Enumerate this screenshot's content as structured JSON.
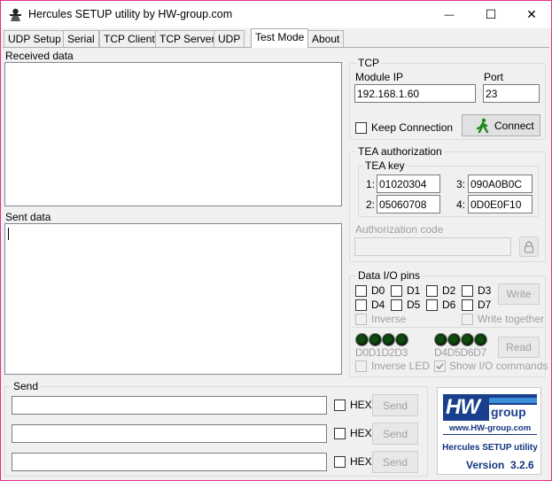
{
  "window": {
    "title": "Hercules SETUP utility by HW-group.com",
    "minimize_glyph": "—",
    "maximize_glyph": "☐",
    "close_glyph": "✕"
  },
  "tabs": [
    {
      "label": "UDP Setup"
    },
    {
      "label": "Serial"
    },
    {
      "label": "TCP Client"
    },
    {
      "label": "TCP Server"
    },
    {
      "label": "UDP"
    },
    {
      "label": "Test Mode",
      "active": true
    },
    {
      "label": "About"
    }
  ],
  "received": {
    "label": "Received data"
  },
  "sent": {
    "label": "Sent data"
  },
  "tcp": {
    "title": "TCP",
    "module_ip_label": "Module IP",
    "module_ip": "192.168.1.60",
    "port_label": "Port",
    "port": "23",
    "keep_connection_label": "Keep Connection",
    "connect_label": "Connect"
  },
  "tea": {
    "title": "TEA authorization",
    "key_title": "TEA key",
    "k1_label": "1:",
    "k1": "01020304",
    "k2_label": "2:",
    "k2": "05060708",
    "k3_label": "3:",
    "k3": "090A0B0C",
    "k4_label": "4:",
    "k4": "0D0E0F10",
    "auth_code_label": "Authorization code"
  },
  "dio": {
    "title": "Data I/O pins",
    "pins_row1": [
      "D0",
      "D1",
      "D2",
      "D3"
    ],
    "pins_row2": [
      "D4",
      "D5",
      "D6",
      "D7"
    ],
    "write_label": "Write",
    "inverse_label": "Inverse",
    "write_together_label": "Write together",
    "led_labels_left": "D0D1D2D3",
    "led_labels_right": "D4D5D6D7",
    "read_label": "Read",
    "inverse_led_label": "Inverse LED",
    "show_io_label": "Show I/O commands",
    "show_io_checked": true
  },
  "send": {
    "title": "Send",
    "rows": [
      {
        "value": "",
        "hex_label": "HEX",
        "send_label": "Send"
      },
      {
        "value": "",
        "hex_label": "HEX",
        "send_label": "Send"
      },
      {
        "value": "",
        "hex_label": "HEX",
        "send_label": "Send"
      }
    ]
  },
  "logo": {
    "hw": "HW",
    "group": "group",
    "url": "www.HW-group.com",
    "product": "Hercules SETUP utility",
    "version_label": "Version",
    "version": "3.2.6",
    "colors": {
      "brand_blue": "#1a3f8c",
      "text_blue": "#10357e"
    }
  }
}
